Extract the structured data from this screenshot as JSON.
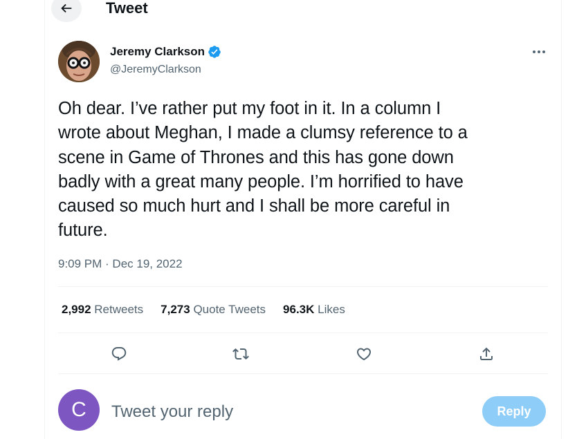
{
  "header": {
    "title": "Tweet",
    "back_icon": "arrow-left-icon"
  },
  "author": {
    "name": "Jeremy Clarkson",
    "handle": "@JeremyClarkson",
    "verified_icon": "verified-badge-icon",
    "verified_color": "#1d9bf0"
  },
  "more_icon": "more-horizontal-icon",
  "tweet": {
    "text": "Oh dear. I’ve rather put my foot in it. In a column I\nwrote about Meghan, I made a clumsy reference to a\nscene in Game of Thrones and this has gone down\nbadly with a great many people. I’m horrified to have\ncaused so much hurt and I shall be more careful in\nfuture.",
    "timestamp": "9:09 PM · Dec 19, 2022"
  },
  "stats": {
    "retweets": {
      "count": "2,992",
      "label": "Retweets"
    },
    "quote_tweets": {
      "count": "7,273",
      "label": "Quote Tweets"
    },
    "likes": {
      "count": "96.3K",
      "label": "Likes"
    }
  },
  "actions": [
    "reply-icon",
    "retweet-icon",
    "like-icon",
    "share-icon"
  ],
  "reply": {
    "avatar_letter": "C",
    "avatar_color": "#7e56c2",
    "placeholder": "Tweet your reply",
    "button_label": "Reply",
    "button_color": "#8ecdf8"
  },
  "colors": {
    "text": "#0f1419",
    "secondary": "#536471",
    "divider": "#eff3f4"
  }
}
